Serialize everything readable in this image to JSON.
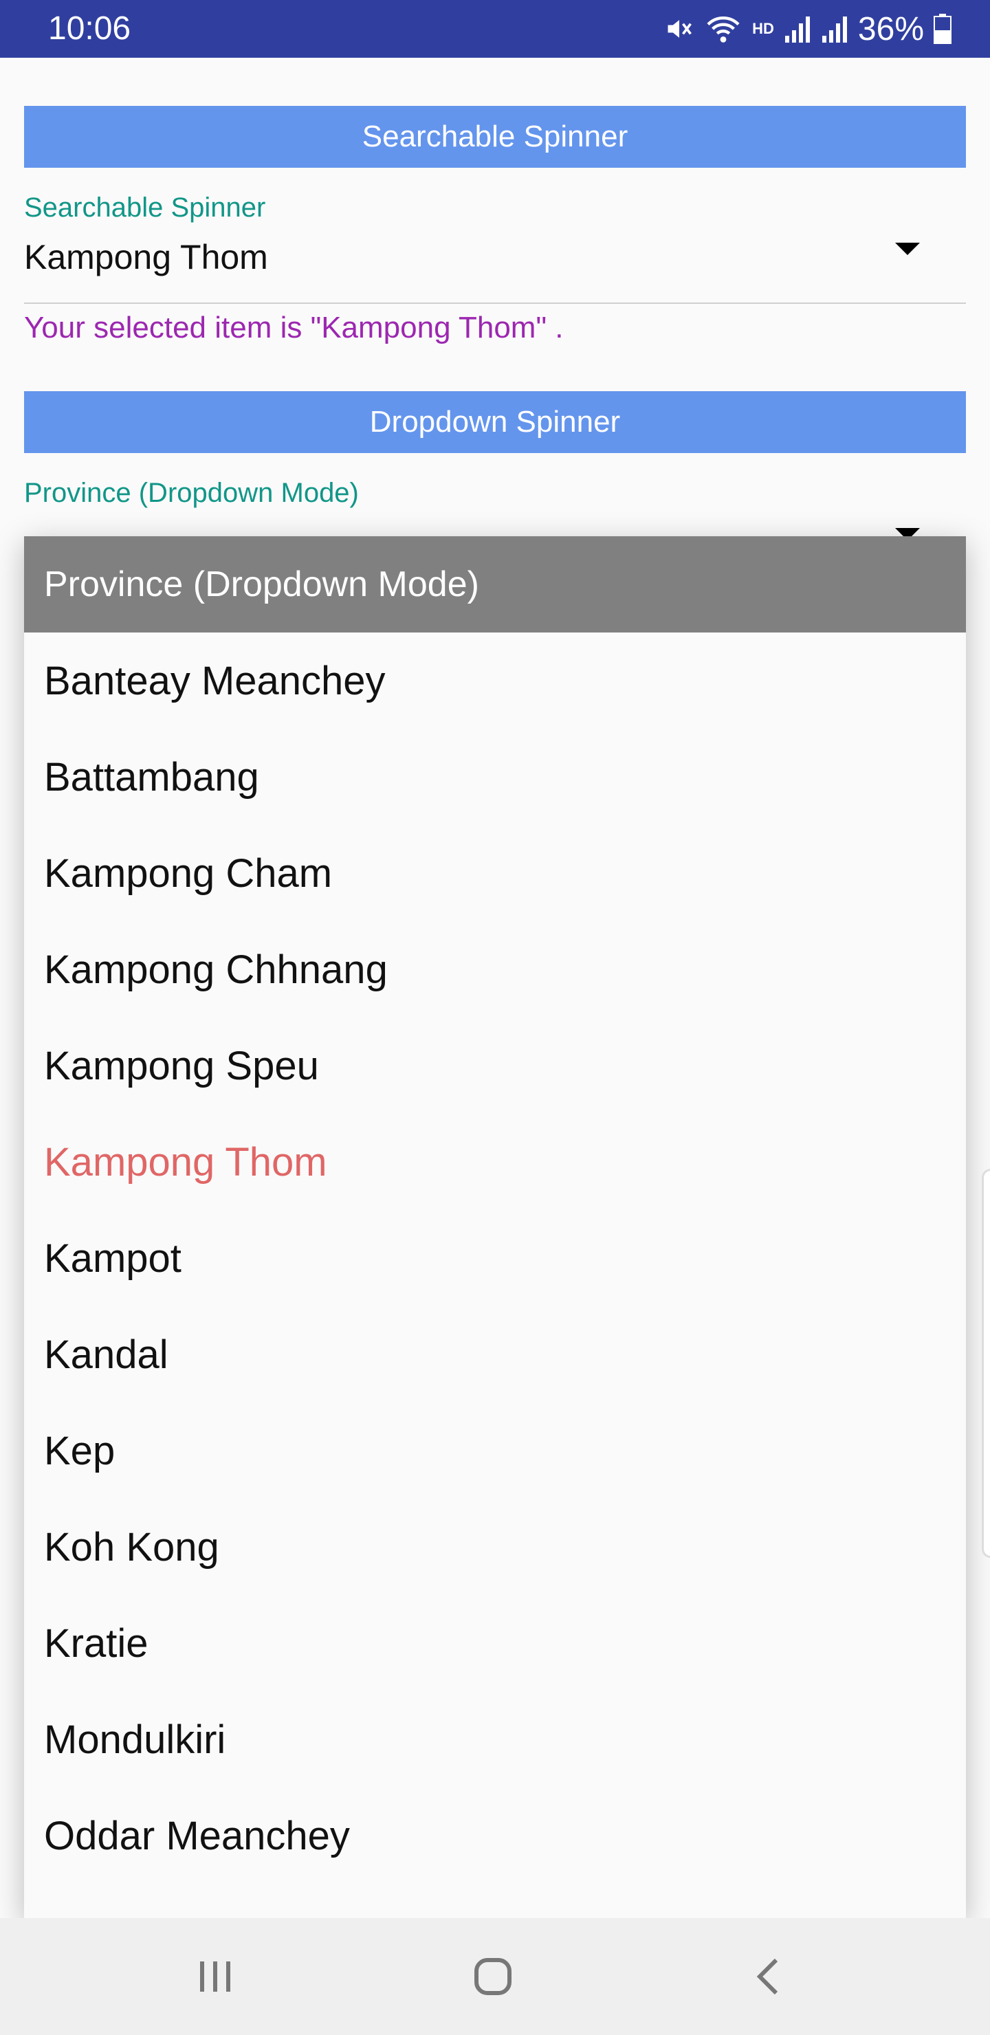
{
  "status_bar": {
    "time": "10:06",
    "battery_percent": "36%",
    "network_label": "HD",
    "icons": [
      "mute-icon",
      "wifi-icon",
      "signal-icon",
      "signal-icon",
      "battery-icon"
    ],
    "color": "#303f9f"
  },
  "searchable_section": {
    "header": "Searchable Spinner",
    "label": "Searchable Spinner",
    "value": "Kampong Thom",
    "selected_message": "Your selected item is \"Kampong Thom\" ."
  },
  "dropdown_section": {
    "header": "Dropdown Spinner",
    "label": "Province (Dropdown Mode)"
  },
  "dropdown_popup": {
    "title": "Province (Dropdown Mode)",
    "items": [
      "Banteay Meanchey",
      "Battambang",
      "Kampong Cham",
      "Kampong Chhnang",
      "Kampong Speu",
      "Kampong Thom",
      "Kampot",
      "Kandal",
      "Kep",
      "Koh Kong",
      "Kratie",
      "Mondulkiri",
      "Oddar Meanchey"
    ],
    "selected_item": "Kampong Thom",
    "selected_color": "#e06666"
  },
  "colors": {
    "header_bar": "#6495ed",
    "label": "#119688",
    "message": "#9c27b0"
  },
  "nav_bar": {
    "buttons": [
      "recents-icon",
      "home-icon",
      "back-icon"
    ]
  }
}
